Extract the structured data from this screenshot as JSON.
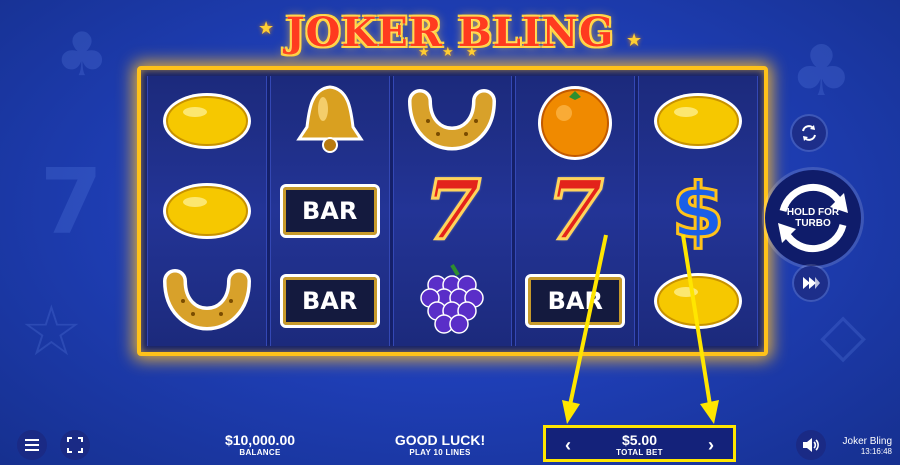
{
  "game": {
    "title": "JOKER BLING"
  },
  "reels": [
    [
      "lemon",
      "lemon",
      "horseshoe"
    ],
    [
      "bell",
      "bar",
      "bar"
    ],
    [
      "horseshoe",
      "seven",
      "grapes"
    ],
    [
      "orange",
      "seven",
      "bar"
    ],
    [
      "lemon",
      "dollar",
      "lemon"
    ]
  ],
  "symbol_text": {
    "bar": "BAR",
    "seven": "7",
    "dollar": "$"
  },
  "controls": {
    "spin_label_line1": "HOLD FOR",
    "spin_label_line2": "TURBO",
    "autoplay_icon": "autoplay-icon",
    "fast_forward_icon": "fast-forward-icon"
  },
  "bottom_bar": {
    "balance_value": "$10,000.00",
    "balance_label": "BALANCE",
    "message": "GOOD LUCK!",
    "message_sub": "PLAY 10 LINES",
    "total_bet_value": "$5.00",
    "total_bet_label": "TOTAL BET",
    "brand_name": "Joker Bling",
    "clock": "13:16:48"
  },
  "colors": {
    "background": "#1f3fb8",
    "frame_gold": "#ffc21a",
    "highlight_yellow": "#ffe600"
  }
}
